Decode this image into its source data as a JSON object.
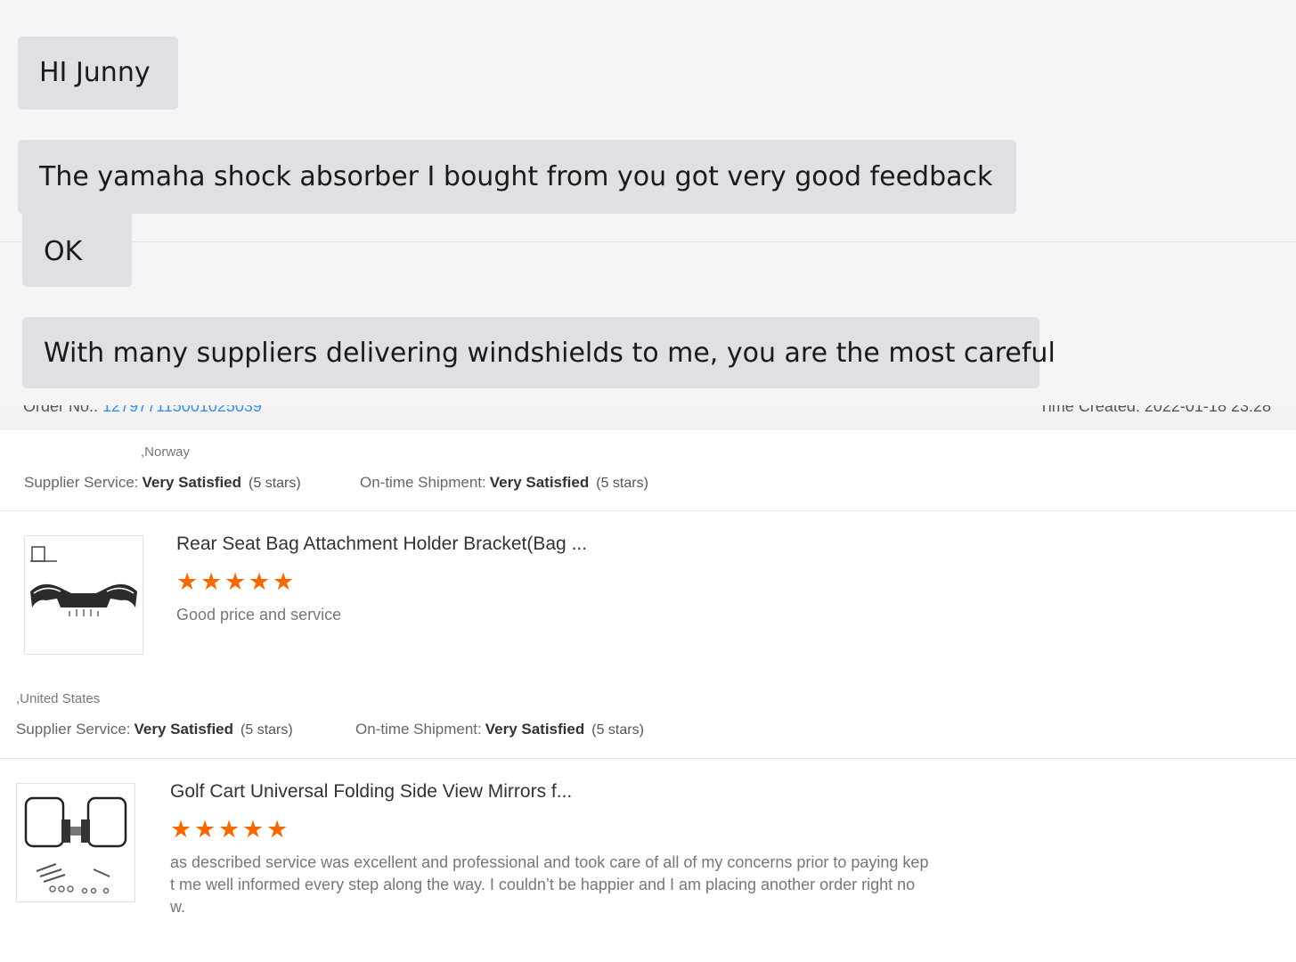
{
  "chat": {
    "messages": [
      "HI Junny",
      "The yamaha shock absorber I bought from you got very good feedback",
      "OK",
      "With many suppliers delivering windshields to me, you are the most careful"
    ]
  },
  "order": {
    "order_no_label": "Order No.:",
    "order_no": "127977115001025039",
    "time_created_label": "Time Created:",
    "time_created": "2022-01-18 23:28"
  },
  "reviews": [
    {
      "country": ",Norway",
      "supplier_service_label": "Supplier Service:",
      "supplier_service_value": "Very Satisfied",
      "supplier_service_stars": "(5 stars)",
      "shipment_label": "On-time Shipment:",
      "shipment_value": "Very Satisfied",
      "shipment_stars": "(5 stars)",
      "product_title": "Rear Seat Bag Attachment Holder Bracket(Bag ...",
      "rating": 5,
      "text": "Good price and service"
    },
    {
      "country": ",United States",
      "supplier_service_label": "Supplier Service:",
      "supplier_service_value": "Very Satisfied",
      "supplier_service_stars": "(5 stars)",
      "shipment_label": "On-time Shipment:",
      "shipment_value": "Very Satisfied",
      "shipment_stars": "(5 stars)",
      "product_title": "Golf Cart Universal Folding Side View Mirrors f...",
      "rating": 5,
      "text_lines": [
        "as described service was excellent and professional and took care of all of my concerns prior to paying kep",
        "t me well informed every step along the way. I couldn’t be happier and I am placing another order right no",
        "w."
      ]
    }
  ],
  "colors": {
    "bubble": "#dfdfe4",
    "chat_bg": "#f5f5f7",
    "star": "#f56a00",
    "link": "#3a8ee6"
  }
}
